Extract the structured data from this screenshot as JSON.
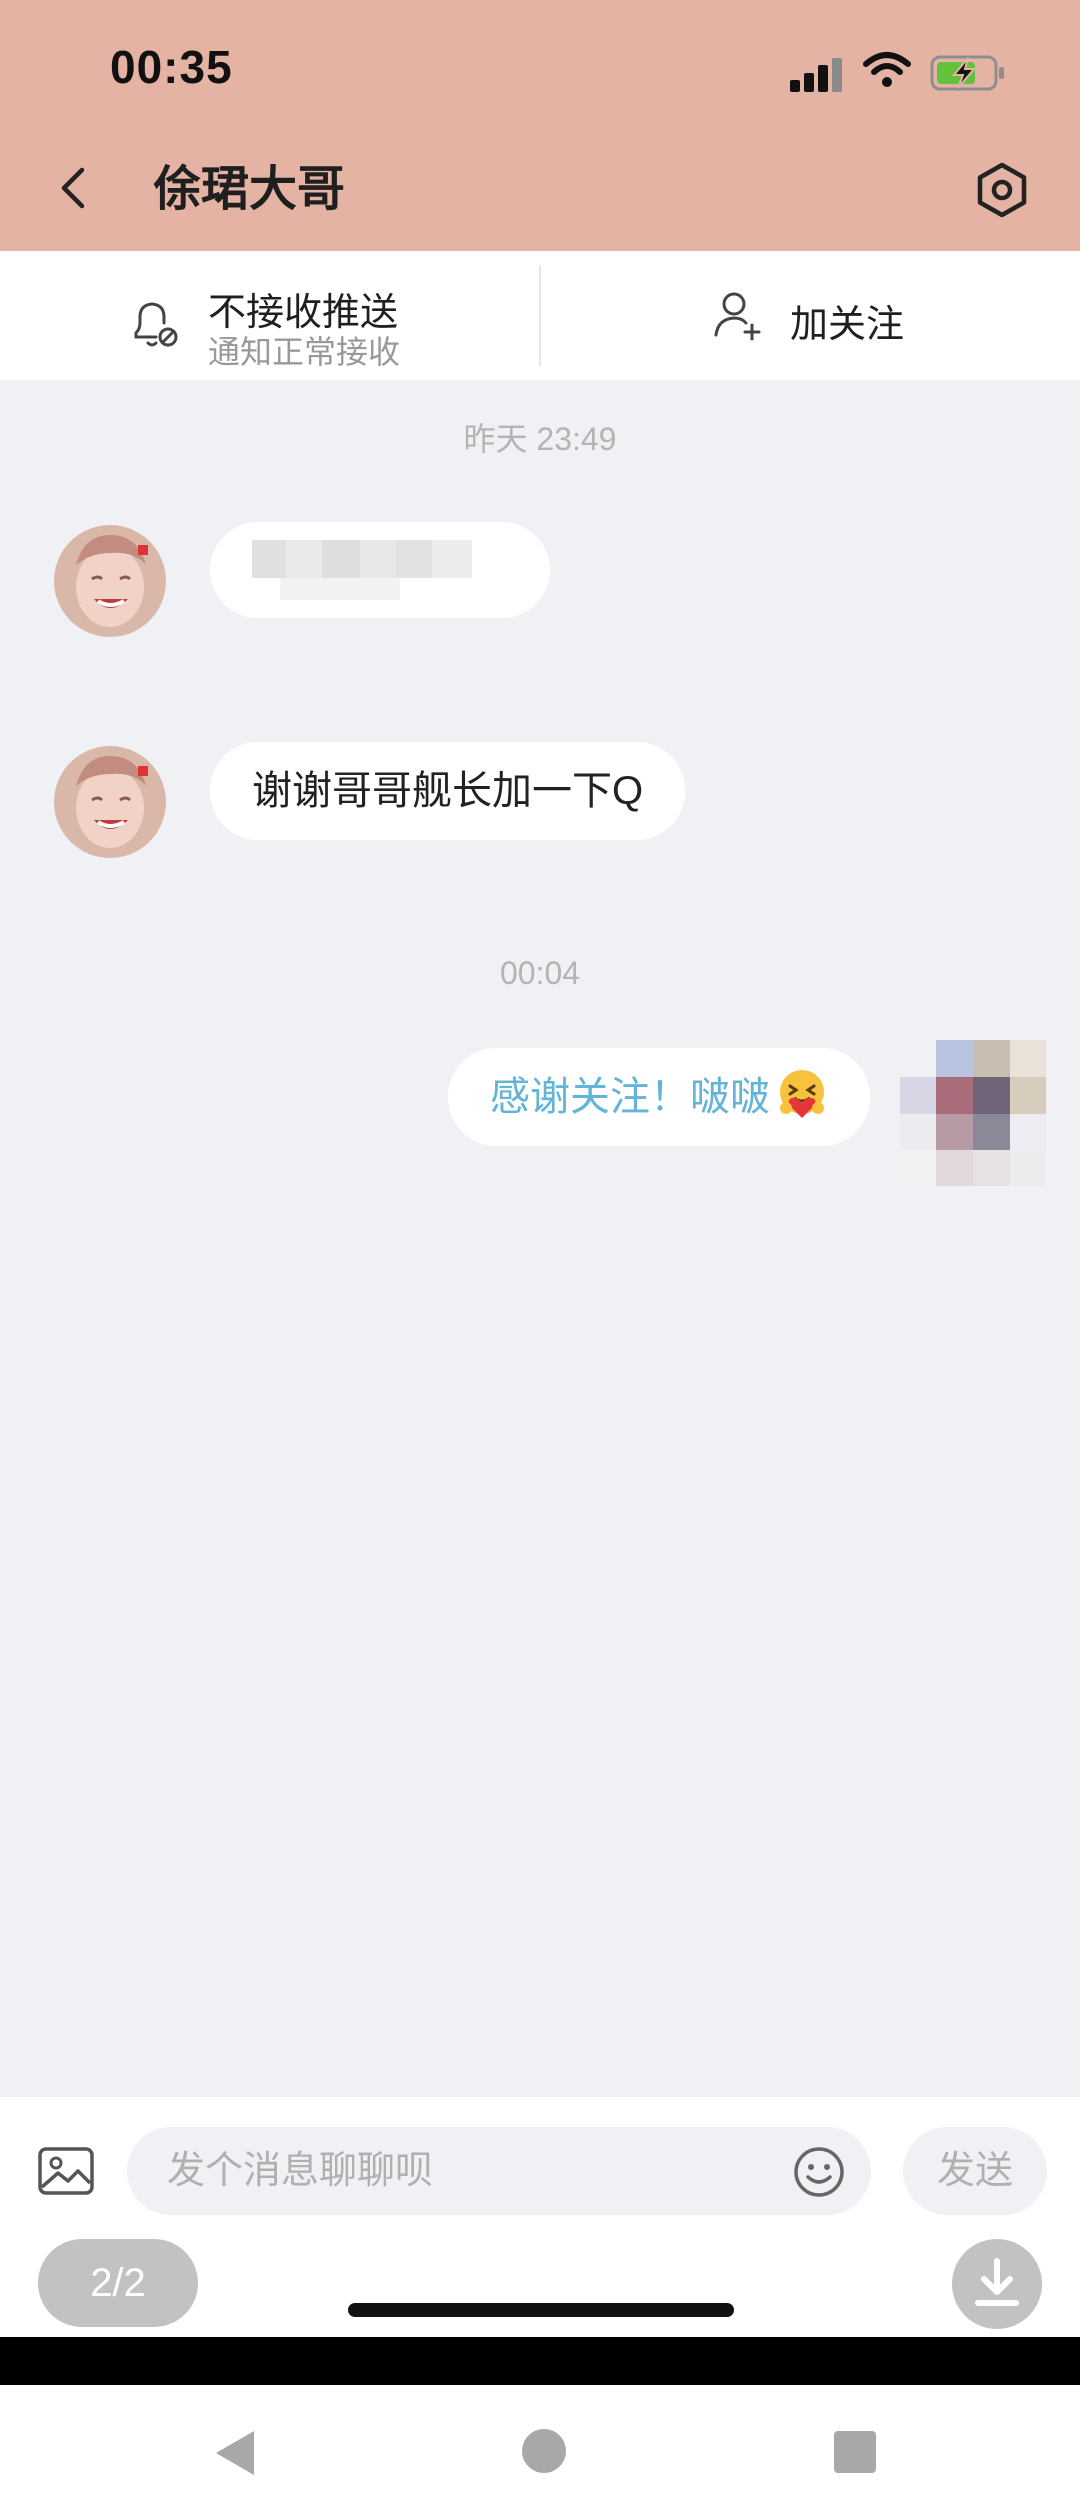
{
  "status_bar": {
    "time": "00:35"
  },
  "header": {
    "title": "俆珺大哥",
    "back_icon": "chevron-left-icon",
    "settings_icon": "hexagon-settings-icon",
    "background_color": "#e4b3a3"
  },
  "actions": {
    "push_title": "不接收推送",
    "push_subtitle": "通知正常接收",
    "follow_label": "加关注"
  },
  "messages": [
    {
      "timestamp": "昨天 23:49",
      "items": [
        {
          "from": "other",
          "text": ""
        },
        {
          "from": "other",
          "text": "谢谢哥哥舰长加一下Q"
        }
      ]
    },
    {
      "timestamp": "00:04",
      "items": [
        {
          "from": "me",
          "text": "感谢关注！啵啵",
          "emoji": "hugging-heart-emoji"
        }
      ]
    }
  ],
  "input_bar": {
    "placeholder": "发个消息聊聊呗",
    "send_label": "发送"
  },
  "overlay": {
    "page_indicator": "2/2"
  },
  "colors": {
    "chat_background": "#f0f1f4",
    "outgoing_text": "#63b4d9"
  }
}
